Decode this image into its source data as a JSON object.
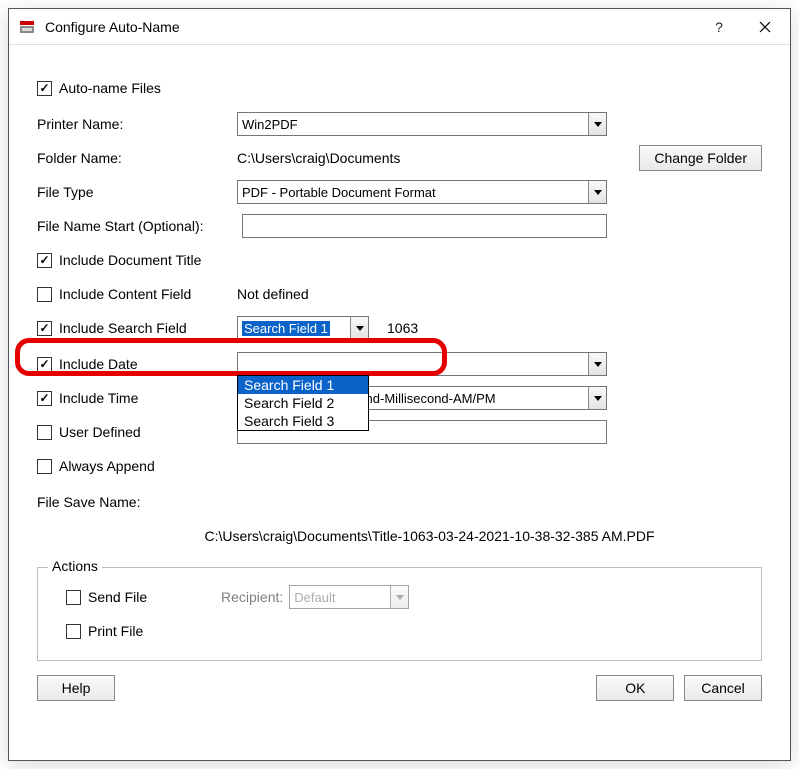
{
  "window": {
    "title": "Configure Auto-Name"
  },
  "autoNameFiles": {
    "label": "Auto-name Files"
  },
  "printerName": {
    "label": "Printer Name:",
    "value": "Win2PDF"
  },
  "folderName": {
    "label": "Folder Name:",
    "value": "C:\\Users\\craig\\Documents",
    "changeBtn": "Change Folder"
  },
  "fileType": {
    "label": "File Type",
    "value": "PDF - Portable Document Format"
  },
  "fileNameStart": {
    "label": "File Name Start (Optional):",
    "value": ""
  },
  "includeDocTitle": {
    "label": "Include Document Title"
  },
  "includeContentField": {
    "label": "Include Content Field",
    "status": "Not defined"
  },
  "includeSearchField": {
    "label": "Include Search Field",
    "selected": "Search Field 1",
    "options": [
      "Search Field 1",
      "Search Field 2",
      "Search Field 3"
    ],
    "extra": "1063"
  },
  "includeDate": {
    "label": "Include Date",
    "value": ""
  },
  "includeTime": {
    "label": "Include Time",
    "value": "12 Hour-Minute-Second-Millisecond-AM/PM"
  },
  "userDefined": {
    "label": "User Defined",
    "value": ""
  },
  "alwaysAppend": {
    "label": "Always Append"
  },
  "fileSaveName": {
    "label": "File Save Name:",
    "value": "C:\\Users\\craig\\Documents\\Title-1063-03-24-2021-10-38-32-385 AM.PDF"
  },
  "actions": {
    "title": "Actions",
    "sendFile": "Send File",
    "recipientLabel": "Recipient:",
    "recipientValue": "Default",
    "printFile": "Print File"
  },
  "buttons": {
    "help": "Help",
    "ok": "OK",
    "cancel": "Cancel"
  }
}
